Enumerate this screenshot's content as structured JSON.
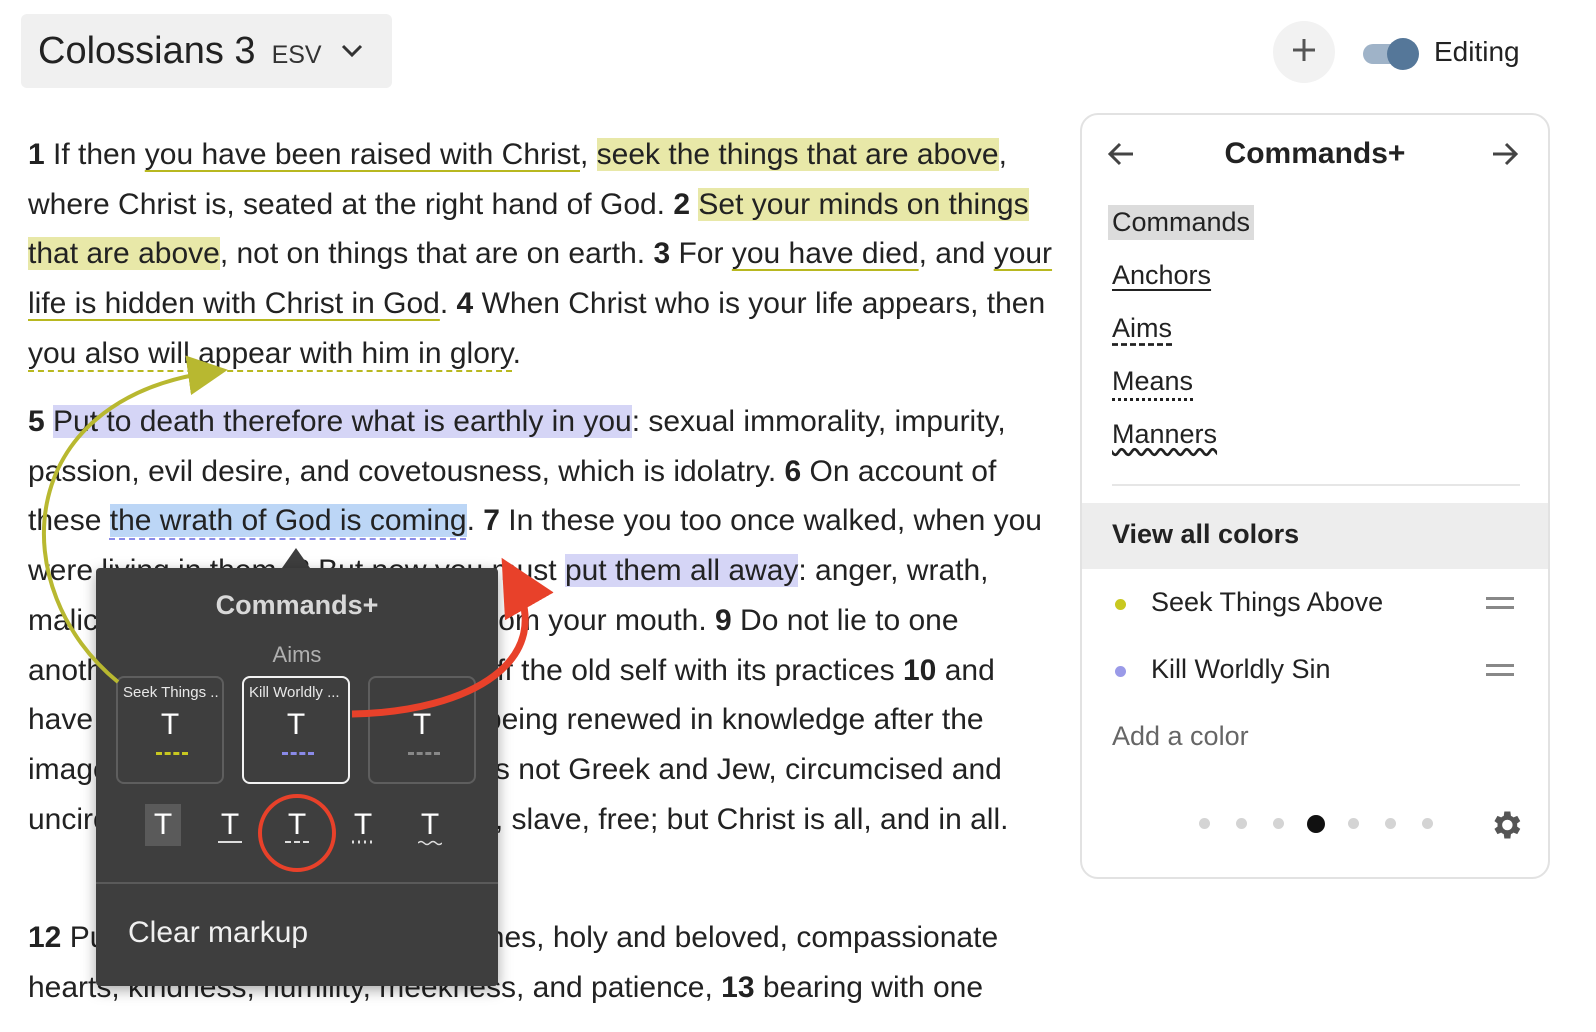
{
  "header": {
    "book": "Colossians 3",
    "version": "ESV",
    "mode_label": "Editing",
    "editing_on": true
  },
  "text": {
    "v1_num": "1",
    "v1_a": "If then ",
    "v1_b": "you have been raised with Christ",
    "v1_c": ", ",
    "v1_d": "seek the things that are above",
    "v1_e": ", where Christ is, seated at the right hand of God. ",
    "v2_num": "2",
    "v2_a": "Set your minds on things that are above",
    "v2_b": ", not on things that are on earth. ",
    "v3_num": "3",
    "v3_a": "For ",
    "v3_b": "you have died",
    "v3_c": ", and ",
    "v3_d": "your life is hidden with Christ in God",
    "v3_e": ". ",
    "v4_num": "4",
    "v4_a": "When Christ who is your life appears, then ",
    "v4_b": "you also will appear with him in glory",
    "v4_c": ".",
    "v5_num": "5",
    "v5_a": "Put to death therefore what is earthly in you",
    "v5_b": ": sexual immorality, impurity, passion, evil desire, and covetousness, which is idolatry. ",
    "v6_num": "6",
    "v6_a": "On account of these ",
    "v6_b": "the wrath of God is coming",
    "v6_c": ". ",
    "v7_num": "7",
    "v7_a": "In these you too once walked, when you were living in them. ",
    "v8_num": "8",
    "v8_a": "But now you must ",
    "v8_b": "put them all away",
    "v8_c": ": anger, wrath, malice, slander, and obscene talk from your mouth. ",
    "v9_num": "9",
    "v9_a": "Do not lie to one another, seeing that you have put off the old self with its practices ",
    "v10_num": "10",
    "v10_a": "and have put on the new self, which is being renewed in knowledge after the image of its creator. ",
    "v11_num": "11",
    "v11_a": "Here there is not Greek and Jew, circumcised and uncircumcised, barbarian, Scythian, slave, free; but Christ is all, and in all.",
    "v12_num": "12",
    "v12_a": "Put on then, as God’s chosen ones, holy and beloved, compassionate hearts, kindness, humility, meekness, and patience, ",
    "v13_num": "13",
    "v13_a": "bearing with one"
  },
  "popup": {
    "title": "Commands+",
    "subtitle": "Aims",
    "swatches": [
      {
        "label": "Seek Things ...",
        "glyph": "T",
        "line_color": "#c8c820",
        "selected": false
      },
      {
        "label": "Kill Worldly ...",
        "glyph": "T",
        "line_color": "#8a8ae8",
        "selected": true
      },
      {
        "label": "",
        "glyph": "T",
        "line_color": "#888888",
        "selected": false
      }
    ],
    "styles": [
      {
        "glyph": "T",
        "name": "highlight"
      },
      {
        "glyph": "T",
        "name": "underline"
      },
      {
        "glyph": "T",
        "name": "dashed"
      },
      {
        "glyph": "T",
        "name": "dotted"
      },
      {
        "glyph": "T",
        "name": "wavy"
      }
    ],
    "clear_label": "Clear markup"
  },
  "panel": {
    "title": "Commands+",
    "markups": [
      "Commands",
      "Anchors",
      "Aims",
      "Means",
      "Manners"
    ],
    "active_markup": "Commands",
    "view_all_label": "View all colors",
    "colors": [
      {
        "name": "Seek Things Above",
        "color": "#c8c820"
      },
      {
        "name": "Kill Worldly Sin",
        "color": "#9a9ae8"
      }
    ],
    "add_color_label": "Add a color",
    "page_count": 7,
    "current_page": 4
  },
  "icons": {
    "version_dropdown": "chevron-down-icon",
    "add": "plus-icon",
    "prev": "arrow-left-icon",
    "next": "arrow-right-icon",
    "drag": "drag-handle-icon",
    "settings": "gear-icon"
  }
}
